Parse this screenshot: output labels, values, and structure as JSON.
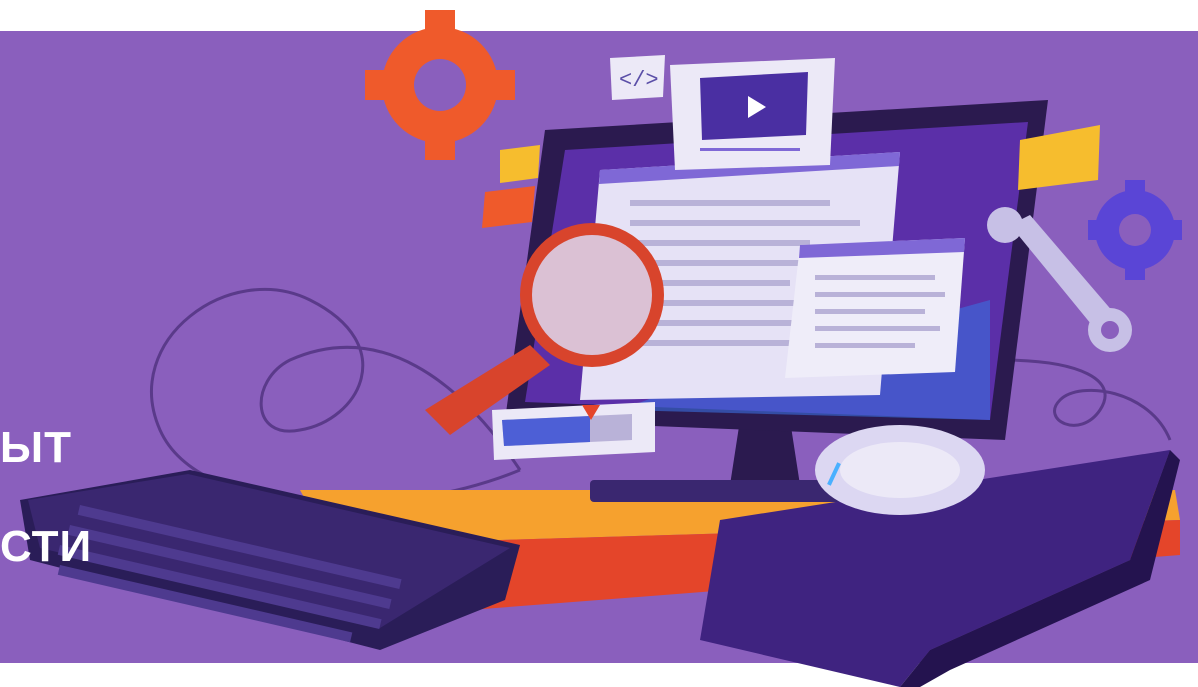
{
  "banner": {
    "headline_line1": "ЫТ",
    "headline_line2": "СТИ",
    "text_color": "#ffffff"
  },
  "colors": {
    "background": "#8a5fbd",
    "page": "#ffffff",
    "monitor": "#2b1a4f",
    "screen": "#5b2fa8",
    "desk_top": "#f6a12e",
    "desk_side": "#e4452a",
    "keyboard": "#3a2770",
    "mousepad": "#3f2380",
    "gear_orange": "#ef5a2b",
    "gear_blue": "#5a45d6",
    "wrench": "#c7c0e6",
    "magnifier": "#d8442c"
  },
  "icons": {
    "code_tag_label": "</>",
    "play_icon": "play-icon"
  }
}
